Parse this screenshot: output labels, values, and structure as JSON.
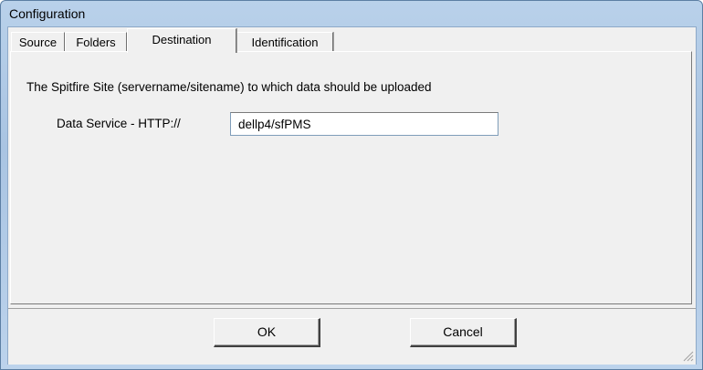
{
  "window": {
    "title": "Configuration"
  },
  "tabs": [
    {
      "label": "Source",
      "active": false
    },
    {
      "label": "Folders",
      "active": false
    },
    {
      "label": "Destination",
      "active": true
    },
    {
      "label": "Identification",
      "active": false
    }
  ],
  "destination": {
    "description": "The Spitfire Site (servername/sitename) to which data should be uploaded",
    "data_service_label": "Data Service - HTTP://",
    "data_service_value": "dellp4/sfPMS"
  },
  "buttons": {
    "ok_label": "OK",
    "cancel_label": "Cancel"
  },
  "icons": {
    "resize": "resize-grip-icon"
  },
  "colors": {
    "titlebar": "#b9d1ea",
    "face": "#f0f0f0"
  }
}
